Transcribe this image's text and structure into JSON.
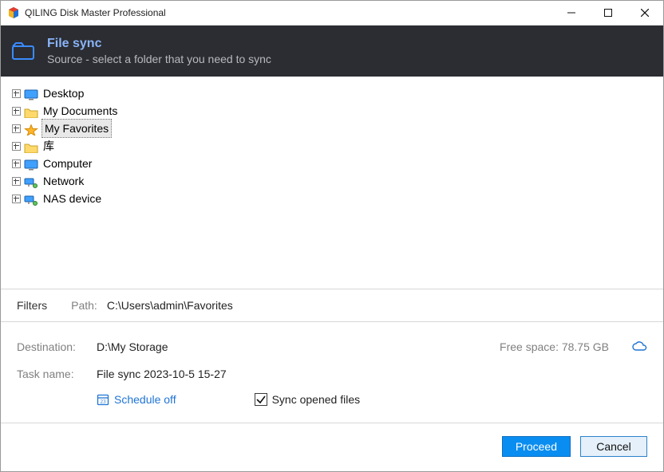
{
  "titlebar": {
    "title": "QILING Disk Master Professional"
  },
  "header": {
    "title": "File sync",
    "subtitle": "Source - select a folder that you need to sync"
  },
  "tree": {
    "items": [
      {
        "label": "Desktop",
        "icon": "monitor"
      },
      {
        "label": "My Documents",
        "icon": "folder"
      },
      {
        "label": "My Favorites",
        "icon": "star",
        "selected": true
      },
      {
        "label": "库",
        "icon": "folder"
      },
      {
        "label": "Computer",
        "icon": "monitor"
      },
      {
        "label": "Network",
        "icon": "network"
      },
      {
        "label": "NAS device",
        "icon": "network"
      }
    ]
  },
  "filters": {
    "filters_label": "Filters",
    "path_label": "Path:",
    "path_value": "C:\\Users\\admin\\Favorites"
  },
  "destination": {
    "label": "Destination:",
    "value": "D:\\My Storage",
    "freespace_label": "Free space: 78.75 GB"
  },
  "taskname": {
    "label": "Task name:",
    "value": "File sync 2023-10-5 15-27"
  },
  "options": {
    "schedule_label": "Schedule off",
    "sync_opened_label": "Sync opened files",
    "sync_opened_checked": true
  },
  "footer": {
    "proceed": "Proceed",
    "cancel": "Cancel"
  }
}
